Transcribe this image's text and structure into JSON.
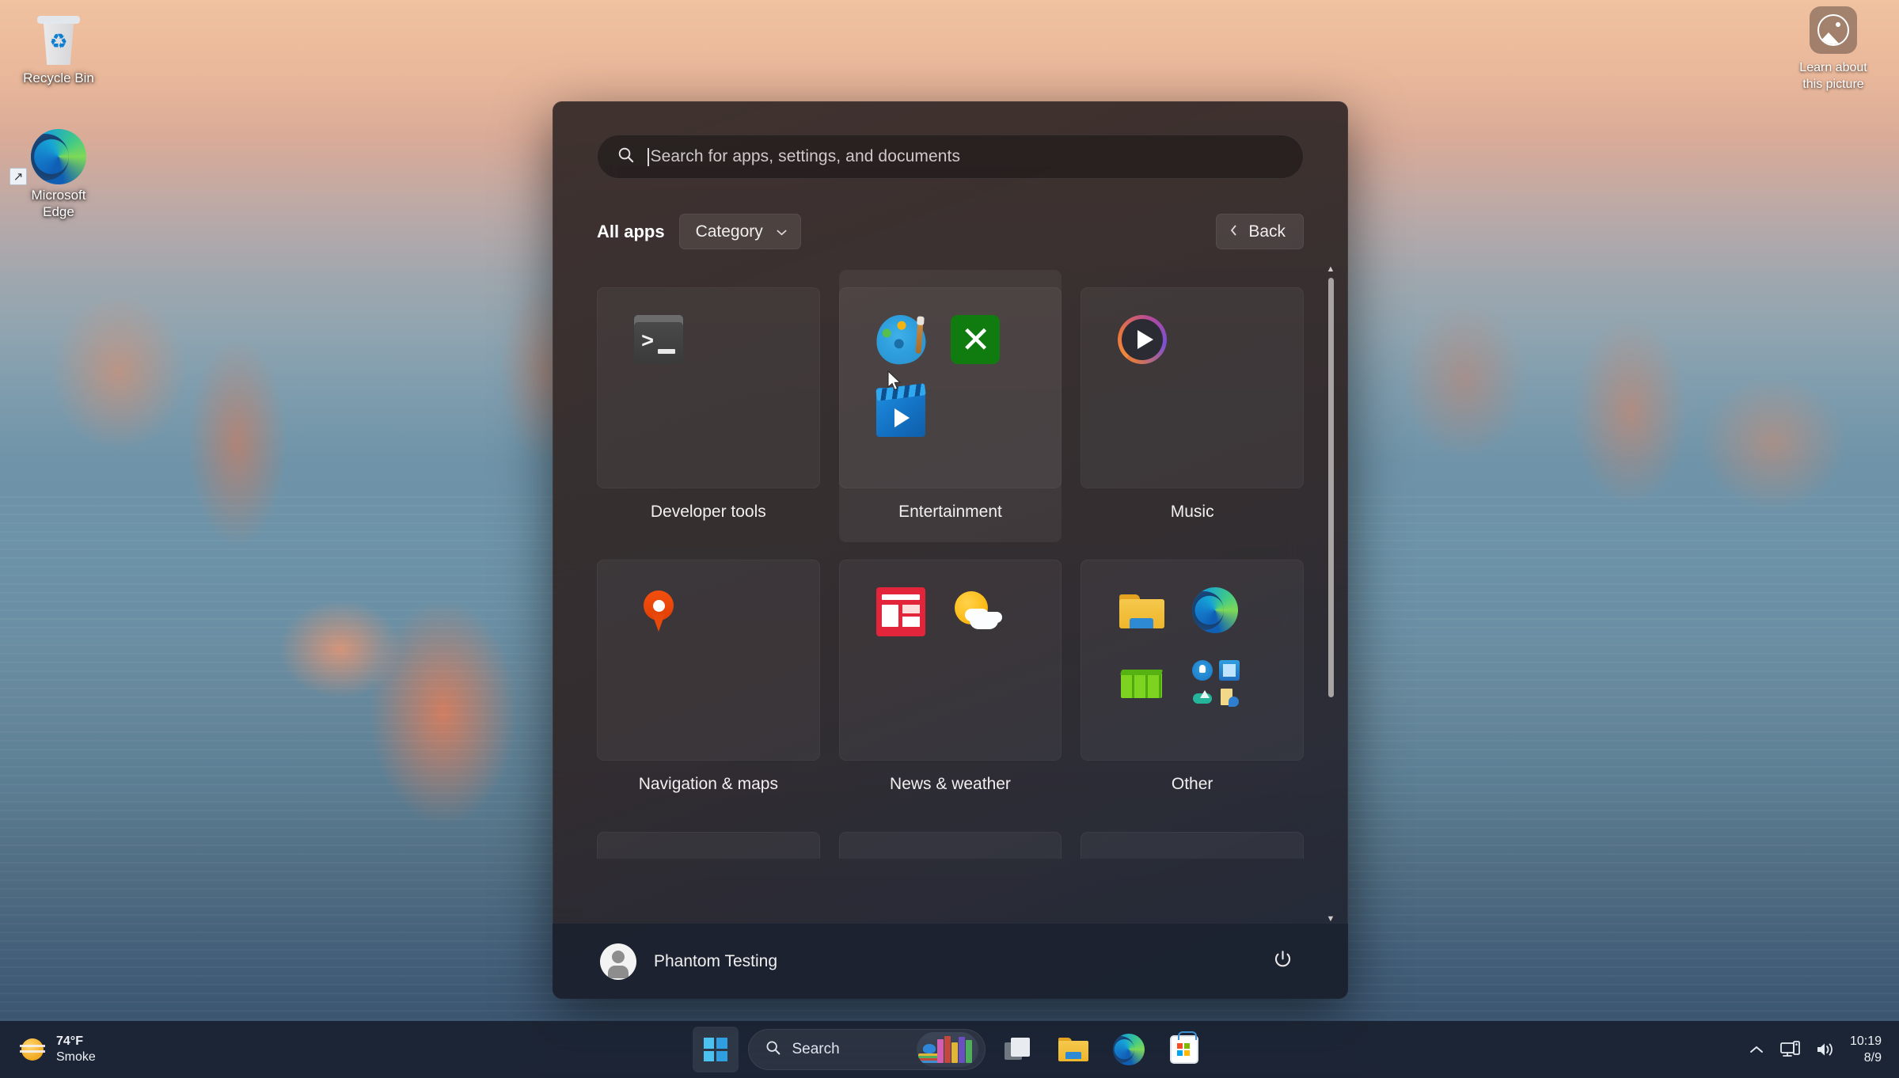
{
  "desktop": {
    "icons": [
      {
        "name": "Recycle Bin",
        "icon": "recycle-bin-icon"
      },
      {
        "name": "Microsoft\nEdge",
        "line1": "Microsoft",
        "line2": "Edge",
        "icon": "microsoft-edge-icon"
      }
    ],
    "learn_widget": {
      "line1": "Learn about",
      "line2": "this picture",
      "icon": "picture-icon"
    }
  },
  "start_menu": {
    "search": {
      "placeholder": "Search for apps, settings, and documents",
      "value": "",
      "icon": "search-icon"
    },
    "header": {
      "all_apps_label": "All apps",
      "category_label": "Category",
      "category_icon": "chevron-down-icon",
      "back_label": "Back",
      "back_icon": "chevron-left-icon"
    },
    "categories": [
      {
        "label": "Developer tools",
        "hovered": false,
        "apps": [
          "terminal"
        ]
      },
      {
        "label": "Entertainment",
        "hovered": true,
        "apps": [
          "paint",
          "xbox",
          "movies-tv"
        ]
      },
      {
        "label": "Music",
        "hovered": false,
        "apps": [
          "media-player"
        ]
      },
      {
        "label": "Navigation & maps",
        "hovered": false,
        "apps": [
          "maps"
        ]
      },
      {
        "label": "News & weather",
        "hovered": false,
        "apps": [
          "news",
          "weather"
        ]
      },
      {
        "label": "Other",
        "hovered": false,
        "apps": [
          "file-explorer",
          "edge",
          "excel",
          "multi-apps"
        ]
      }
    ],
    "scrollbar": {
      "up_icon": "triangle-up-icon",
      "down_icon": "triangle-down-icon",
      "thumb_position": "top"
    },
    "footer": {
      "user_name": "Phantom Testing",
      "avatar_icon": "user-avatar-icon",
      "power_icon": "power-icon"
    }
  },
  "taskbar": {
    "weather": {
      "temperature": "74°F",
      "condition": "Smoke",
      "icon": "smoke-weather-icon"
    },
    "start_button": {
      "icon": "windows-logo-icon"
    },
    "search": {
      "label": "Search",
      "icon": "search-icon",
      "thumbnail": "books-image"
    },
    "apps": [
      {
        "name": "Task View",
        "icon": "task-view-icon"
      },
      {
        "name": "File Explorer",
        "icon": "file-explorer-icon"
      },
      {
        "name": "Microsoft Edge",
        "icon": "microsoft-edge-icon"
      },
      {
        "name": "Microsoft Store",
        "icon": "microsoft-store-icon"
      }
    ],
    "tray": [
      {
        "name": "Show hidden icons",
        "icon": "chevron-up-icon"
      },
      {
        "name": "Network",
        "icon": "network-icon"
      },
      {
        "name": "Volume",
        "icon": "volume-icon"
      }
    ],
    "clock": {
      "time": "10:19",
      "date": "8/9"
    }
  }
}
